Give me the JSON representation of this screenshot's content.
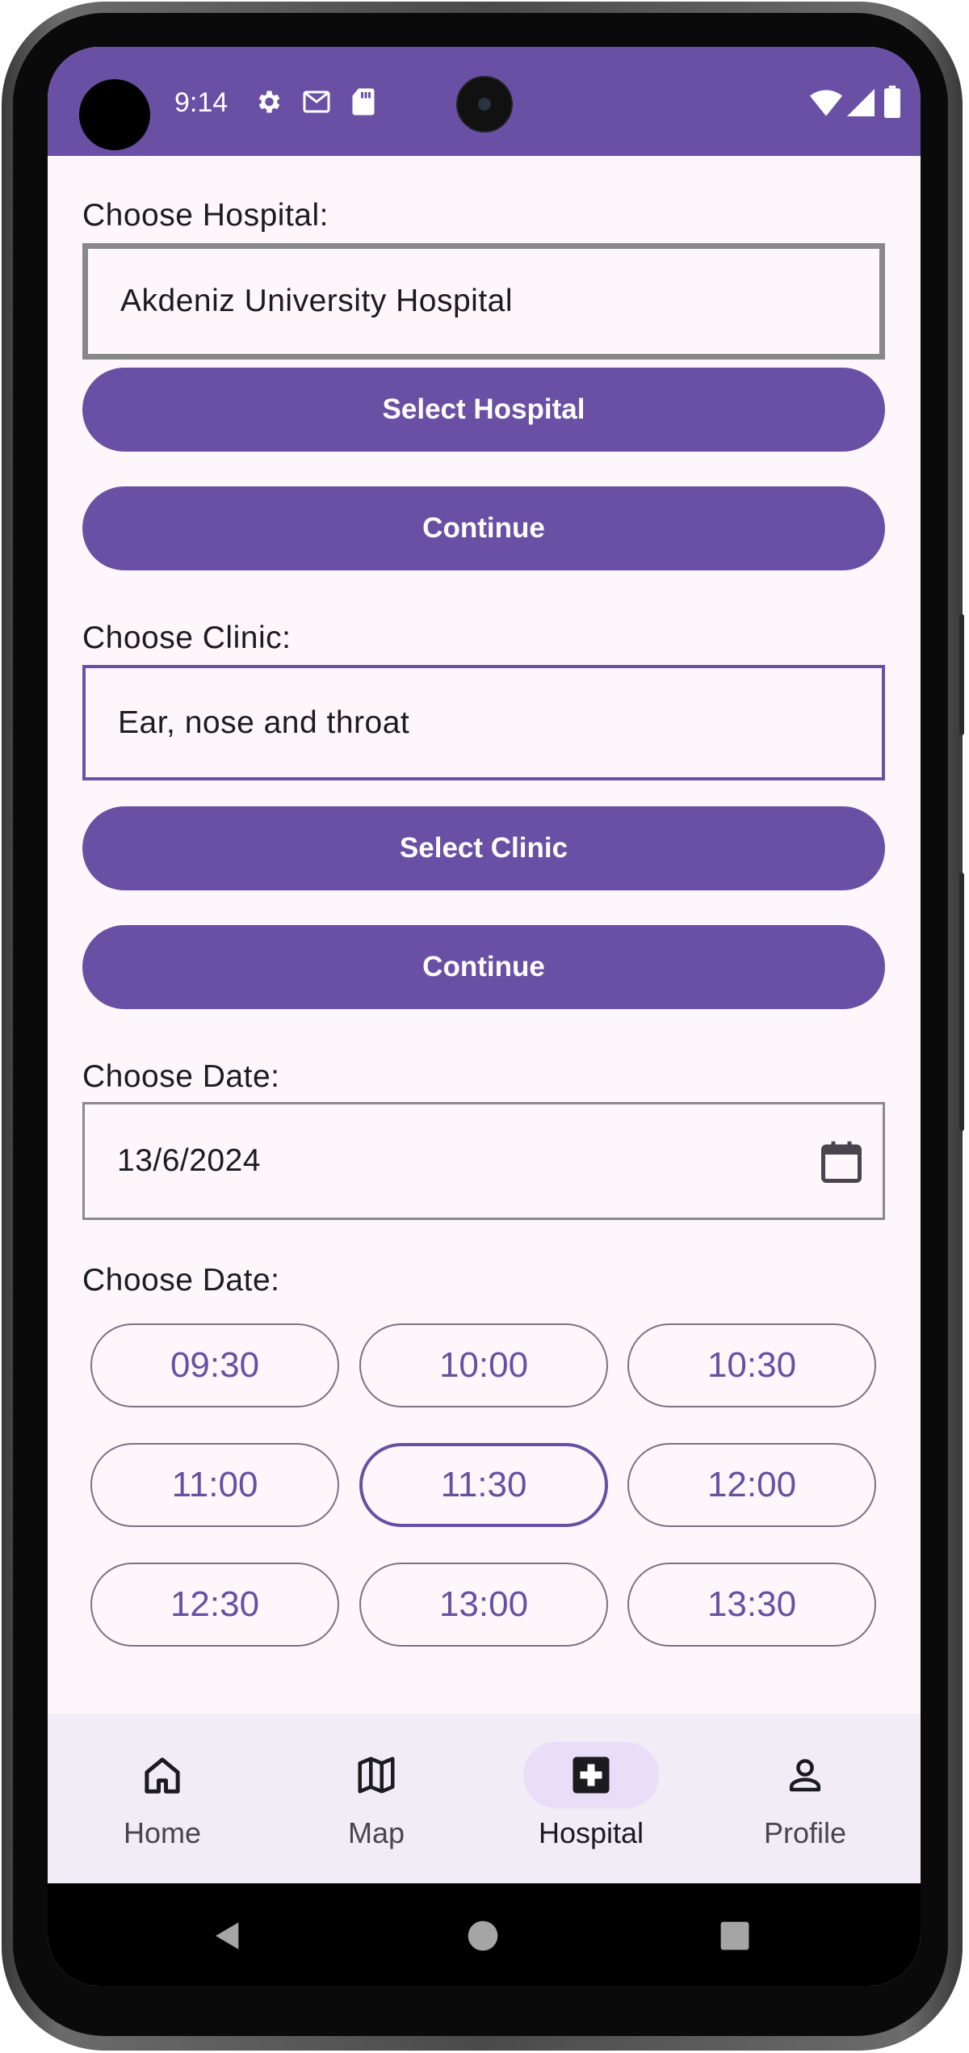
{
  "status_bar": {
    "time": "9:14",
    "left_icons": [
      "gear-icon",
      "gmail-icon",
      "sd-card-icon"
    ],
    "right_icons": [
      "wifi-icon",
      "signal-icon",
      "battery-icon"
    ]
  },
  "hospital_section": {
    "label": "Choose Hospital:",
    "value": "Akdeniz University Hospital",
    "select_button": "Select Hospital",
    "continue_button": "Continue"
  },
  "clinic_section": {
    "label": "Choose Clinic:",
    "value": "Ear, nose and throat",
    "select_button": "Select Clinic",
    "continue_button": "Continue"
  },
  "date_section": {
    "label": "Choose Date:",
    "value": "13/6/2024"
  },
  "time_section": {
    "label": "Choose Date:",
    "slots": [
      "09:30",
      "10:00",
      "10:30",
      "11:00",
      "11:30",
      "12:00",
      "12:30",
      "13:00",
      "13:30"
    ],
    "selected": "11:30"
  },
  "bottom_nav": {
    "items": [
      {
        "label": "Home",
        "icon": "home-icon"
      },
      {
        "label": "Map",
        "icon": "map-icon"
      },
      {
        "label": "Hospital",
        "icon": "hospital-icon"
      },
      {
        "label": "Profile",
        "icon": "profile-icon"
      }
    ],
    "active": "Hospital"
  },
  "colors": {
    "primary": "#6a50a4",
    "chip_text": "#6750a4",
    "background": "#fdf7fc",
    "nav_background": "#f2ecf6",
    "nav_active_pill": "#e8def8"
  }
}
